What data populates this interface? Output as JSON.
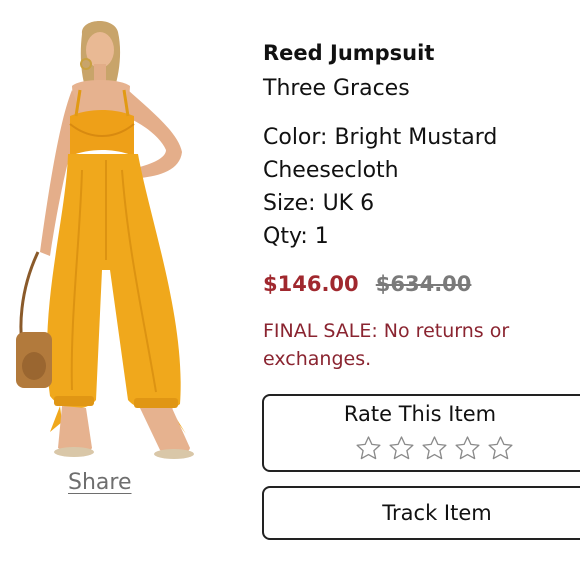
{
  "product": {
    "title": "Reed Jumpsuit",
    "brand": "Three Graces",
    "color": "Color: Bright Mustard Cheesecloth",
    "color_line1": "Color: Bright Mustard",
    "color_line2": "Cheesecloth",
    "size": "Size: UK 6",
    "qty": "Qty: 1",
    "price_sale": "$146.00",
    "price_original": "$634.00",
    "final_sale_notice": "FINAL SALE: No returns or exchanges.",
    "final_sale_line1": "FINAL SALE: No returns or",
    "final_sale_line2": "exchanges.",
    "image_icon": "product-photo-jumpsuit"
  },
  "share": {
    "label": "Share"
  },
  "rating": {
    "title": "Rate This Item",
    "star_count": 5,
    "selected": 0,
    "star_icon": "star-outline-icon"
  },
  "track": {
    "label": "Track Item"
  },
  "colors": {
    "sale_price": "#a0282e",
    "original_price": "#7a7a7a",
    "final_sale": "#8a2430",
    "garment": "#f0a81c",
    "border": "#222222"
  }
}
